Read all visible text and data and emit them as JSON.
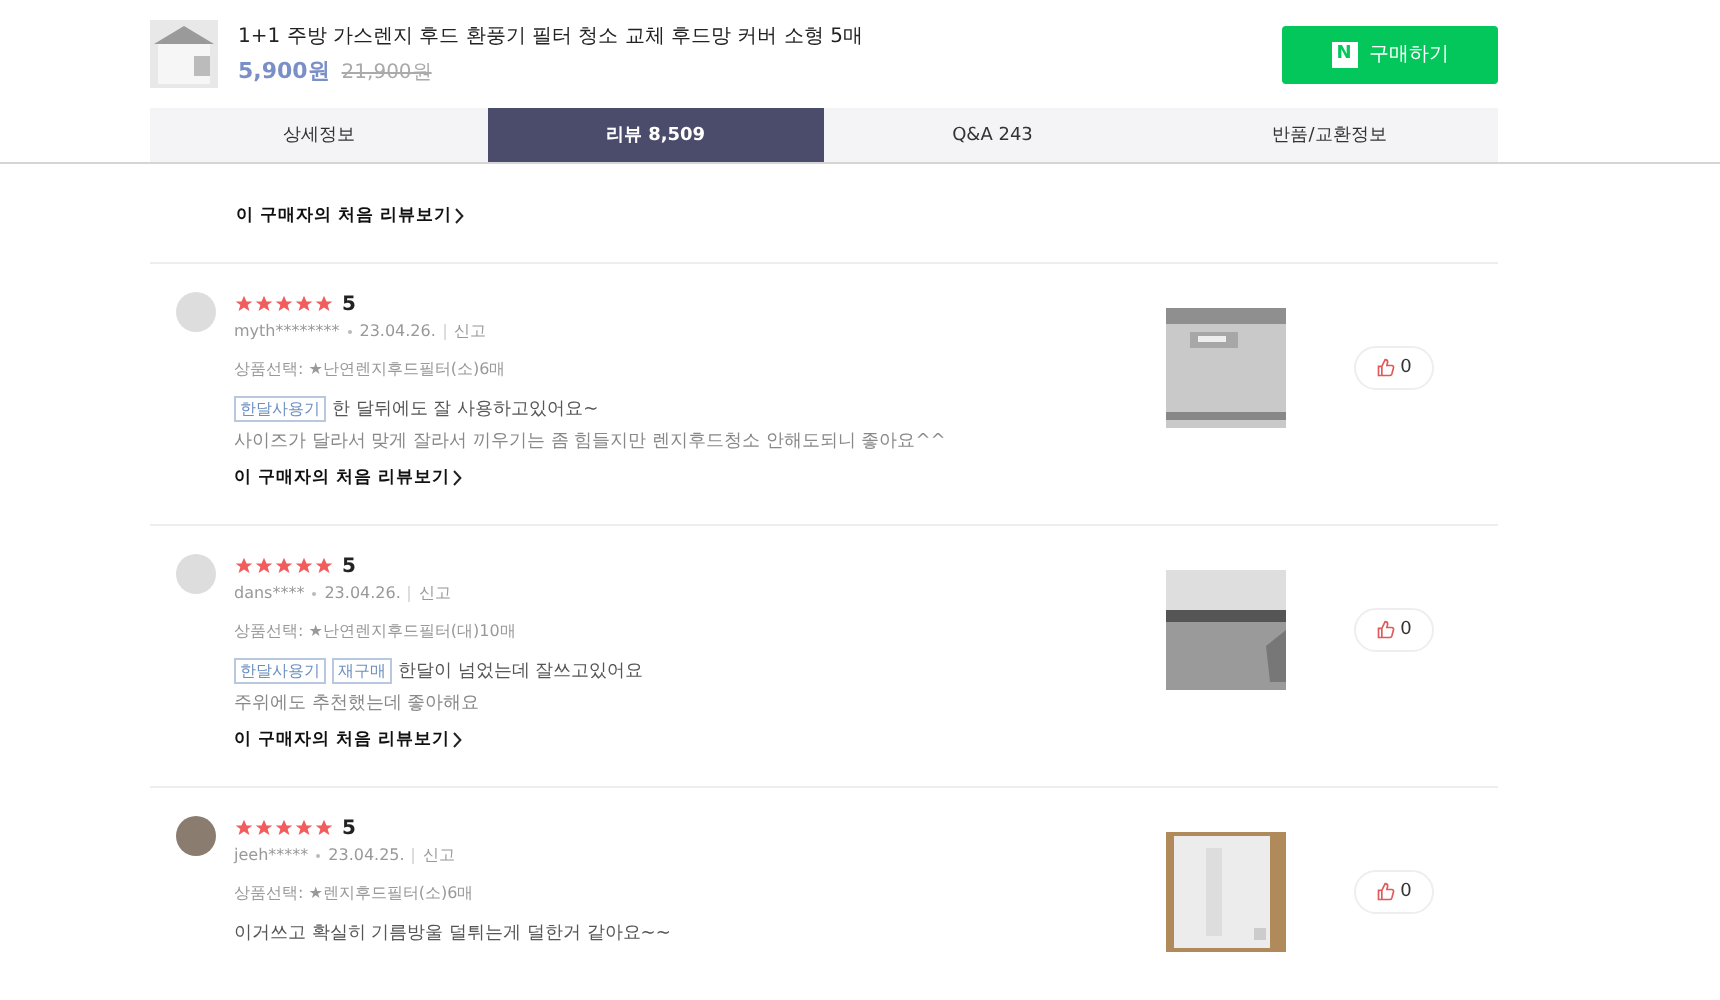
{
  "product": {
    "title": "1+1 주방 가스렌지 후드 환풍기 필터 청소 교체 후드망 커버 소형 5매",
    "price": "5,900원",
    "original_price": "21,900원"
  },
  "buy_button": {
    "logo": "N",
    "label": "구매하기"
  },
  "tabs": [
    {
      "label": "상세정보",
      "selected": false
    },
    {
      "label": "리뷰 8,509",
      "selected": true
    },
    {
      "label": "Q&A 243",
      "selected": false
    },
    {
      "label": "반품/교환정보",
      "selected": false
    }
  ],
  "previous_review": {
    "link": "이 구매자의 처음 리뷰보기"
  },
  "reviews": [
    {
      "stars": 5,
      "score": "5",
      "user": "myth********",
      "date": "23.04.26.",
      "report": "신고",
      "option": "상품선택: ★난연렌지후드필터(소)6매",
      "tags": [
        "한달사용기"
      ],
      "lines": [
        "한 달뒤에도 잘 사용하고있어요~",
        "사이즈가 달라서 맞게 잘라서 끼우기는 좀 힘들지만 렌지후드청소 안해도되니 좋아요^^"
      ],
      "link": "이 구매자의 처음 리뷰보기",
      "likes": "0",
      "avatar_photo": false
    },
    {
      "stars": 5,
      "score": "5",
      "user": "dans****",
      "date": "23.04.26.",
      "report": "신고",
      "option": "상품선택: ★난연렌지후드필터(대)10매",
      "tags": [
        "한달사용기",
        "재구매"
      ],
      "lines": [
        "한달이 넘었는데 잘쓰고있어요",
        "주위에도 추천했는데 좋아해요"
      ],
      "link": "이 구매자의 처음 리뷰보기",
      "likes": "0",
      "avatar_photo": false
    },
    {
      "stars": 5,
      "score": "5",
      "user": "jeeh*****",
      "date": "23.04.25.",
      "report": "신고",
      "option": "상품선택: ★렌지후드필터(소)6매",
      "lines": [
        "이거쓰고 확실히 기름방울 덜튀는게 덜한거 같아요~~"
      ],
      "likes": "0",
      "avatar_photo": true
    }
  ]
}
